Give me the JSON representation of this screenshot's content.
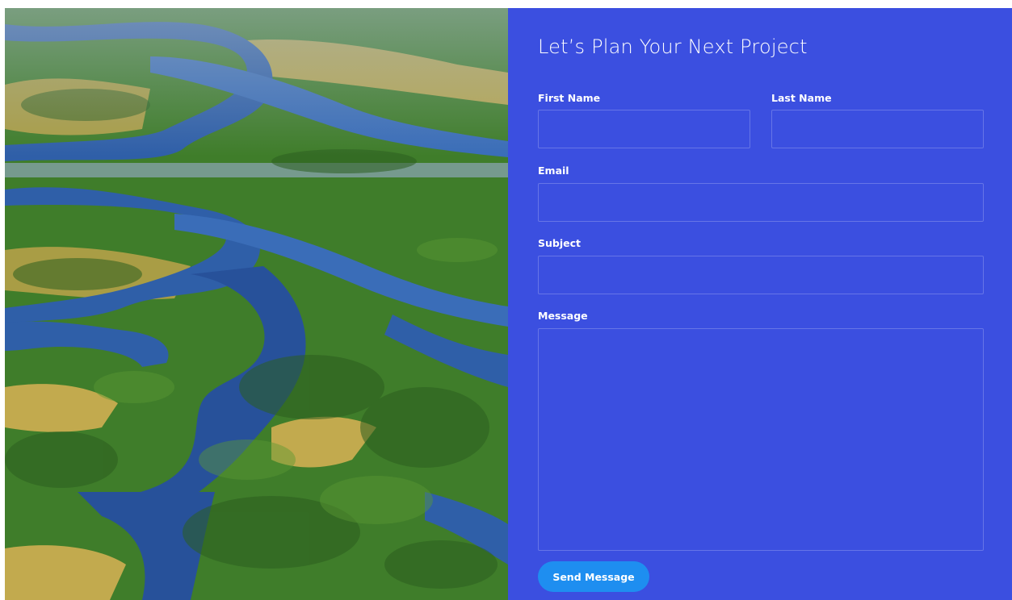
{
  "hero_image": {
    "subject": "aerial-wetland-photo",
    "colors": {
      "water": "#2f5fa8",
      "water_light": "#6a9bd6",
      "mangrove": "#3f7d2a",
      "mangrove_dark": "#2c5e1f",
      "marsh": "#b8a64a",
      "sky_haze": "#9fb4c8"
    }
  },
  "form": {
    "title": "Let’s Plan Your Next Project",
    "fields": {
      "first_name": {
        "label": "First Name",
        "value": "",
        "placeholder": ""
      },
      "last_name": {
        "label": "Last Name",
        "value": "",
        "placeholder": ""
      },
      "email": {
        "label": "Email",
        "value": "",
        "placeholder": ""
      },
      "subject": {
        "label": "Subject",
        "value": "",
        "placeholder": ""
      },
      "message": {
        "label": "Message",
        "value": "",
        "placeholder": ""
      }
    },
    "submit_label": "Send Message"
  },
  "theme": {
    "panel_bg": "#3b4fe0",
    "button_bg": "#1e8ef0",
    "text": "#ffffff"
  }
}
